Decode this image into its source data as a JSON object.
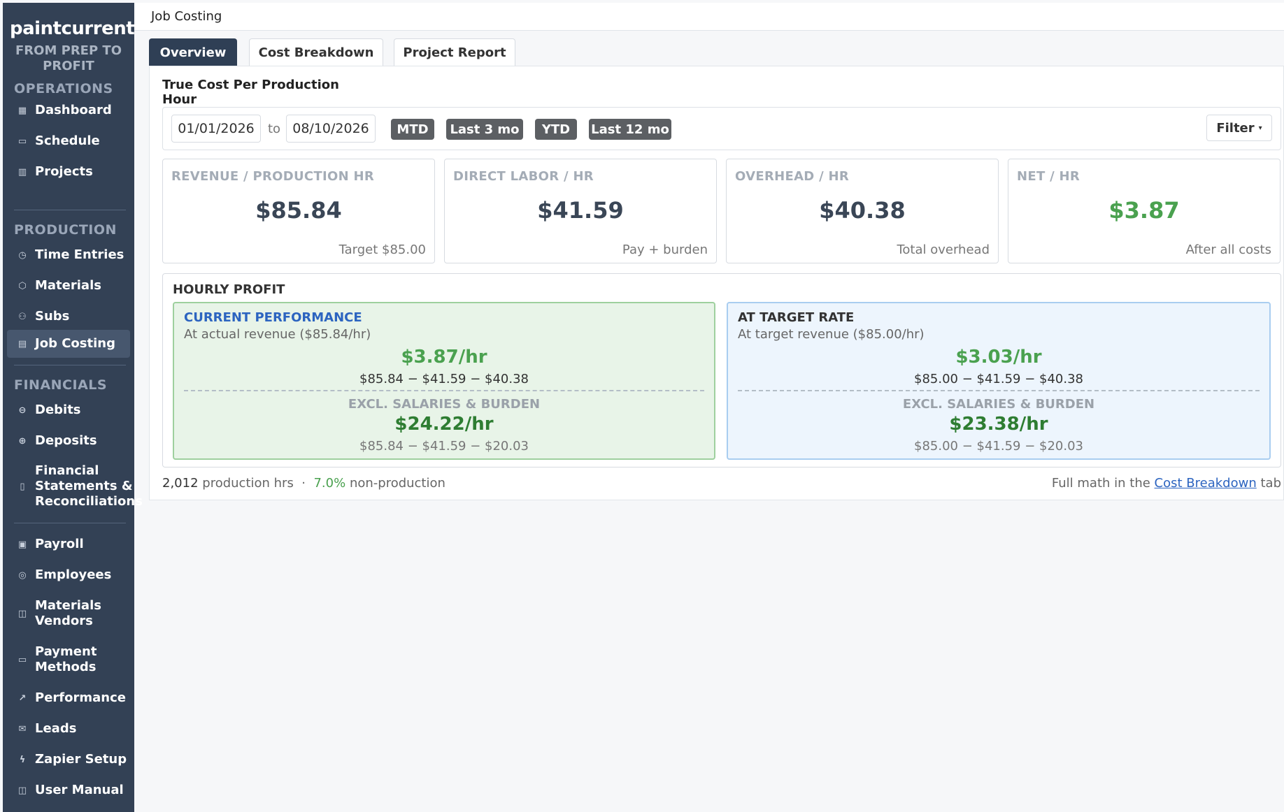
{
  "brand": {
    "name": "paintcurrent",
    "tagline": "FROM PREP TO PROFIT"
  },
  "sidebar": {
    "sections": {
      "operations": "OPERATIONS",
      "production": "PRODUCTION",
      "financials": "FINANCIALS"
    },
    "items": {
      "dashboard": "Dashboard",
      "schedule": "Schedule",
      "projects": "Projects",
      "time_entries": "Time Entries",
      "materials": "Materials",
      "subs": "Subs",
      "job_costing": "Job Costing",
      "debits": "Debits",
      "deposits": "Deposits",
      "financial_statements": "Financial Statements & Reconciliations",
      "payroll": "Payroll",
      "employees": "Employees",
      "materials_vendors": "Materials Vendors",
      "payment_methods": "Payment Methods",
      "performance": "Performance",
      "leads": "Leads",
      "zapier_setup": "Zapier Setup",
      "user_manual": "User Manual"
    }
  },
  "header": {
    "title": "Job Costing"
  },
  "tabs": {
    "overview": "Overview",
    "cost_breakdown": "Cost Breakdown",
    "project_report": "Project Report"
  },
  "panel": {
    "title": "True Cost Per Production Hour"
  },
  "filter": {
    "start_date": "01/01/2026",
    "to": "to",
    "end_date": "08/10/2026",
    "presets": {
      "mtd": "MTD",
      "last3": "Last 3 mo",
      "ytd": "YTD",
      "last12": "Last 12 mo"
    },
    "filter_label": "Filter",
    "caret": "▾"
  },
  "cards": {
    "revenue": {
      "label": "REVENUE / PRODUCTION HR",
      "value": "$85.84",
      "note": "Target $85.00"
    },
    "labor": {
      "label": "DIRECT LABOR / HR",
      "value": "$41.59",
      "note": "Pay + burden"
    },
    "overhead": {
      "label": "OVERHEAD / HR",
      "value": "$40.38",
      "note": "Total overhead"
    },
    "net": {
      "label": "NET / HR",
      "value": "$3.87",
      "note": "After all costs"
    }
  },
  "profit": {
    "title": "HOURLY PROFIT",
    "current": {
      "head": "CURRENT PERFORMANCE",
      "sub": "At actual revenue ($85.84/hr)",
      "big": "$3.87/hr",
      "math": "$85.84 − $41.59 − $40.38",
      "excl": "EXCL. SALARIES & BURDEN",
      "big2": "$24.22/hr",
      "math2": "$85.84 − $41.59 − $20.03"
    },
    "target": {
      "head": "AT TARGET RATE",
      "sub": "At target revenue ($85.00/hr)",
      "big": "$3.03/hr",
      "math": "$85.00 − $41.59 − $40.38",
      "excl": "EXCL. SALARIES & BURDEN",
      "big2": "$23.38/hr",
      "math2": "$85.00 − $41.59 − $20.03"
    }
  },
  "footer": {
    "hours": "2,012",
    "hours_label": "production hrs",
    "sep": "·",
    "pct": "7.0%",
    "pct_label": "non-production",
    "math_prefix": "Full math in the",
    "link": "Cost Breakdown",
    "suffix": "tab"
  },
  "colors": {
    "sidebar": "#334155",
    "active_tab": "#2f3f55",
    "green": "#4aa14f",
    "link": "#2c64c0"
  }
}
